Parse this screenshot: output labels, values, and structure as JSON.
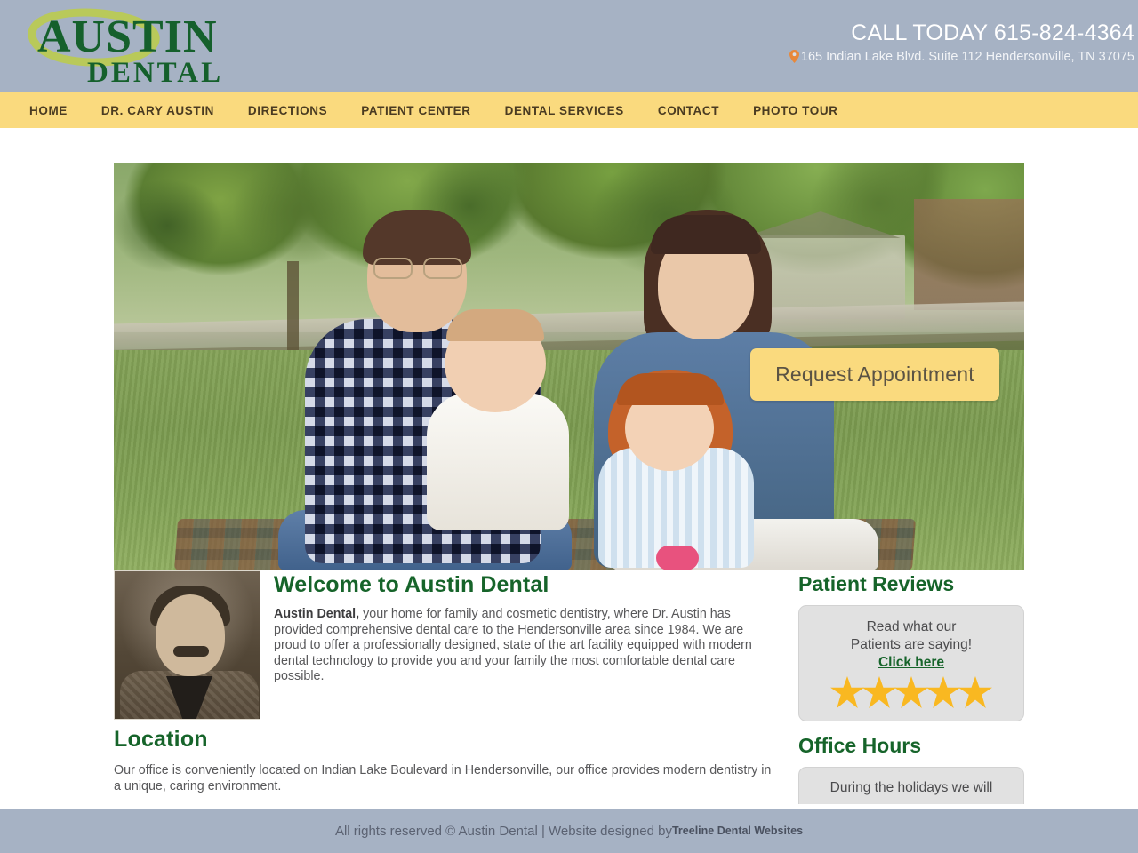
{
  "header": {
    "logo": {
      "primary": "AUSTIN",
      "secondary": "DENTAL",
      "green": "#15602c",
      "swoosh": "#b9c95a"
    },
    "call_today": "CALL TODAY 615-824-4364",
    "address": "165 Indian Lake Blvd. Suite 112 Hendersonville, TN 37075",
    "pin_icon": "map-pin-icon",
    "pin_color": "#e8883a",
    "background": "#a6b2c4"
  },
  "nav": {
    "background": "#fada7e",
    "items": [
      {
        "label": "HOME"
      },
      {
        "label": "DR. CARY AUSTIN"
      },
      {
        "label": "DIRECTIONS"
      },
      {
        "label": "PATIENT CENTER"
      },
      {
        "label": "DENTAL SERVICES"
      },
      {
        "label": "CONTACT"
      },
      {
        "label": "PHOTO TOUR"
      }
    ]
  },
  "hero": {
    "alt": "Family of four sitting on a blanket on grass in a park",
    "cta_label": "Request Appointment",
    "cta_background": "#fada7e",
    "cta_text_color": "#5b5344"
  },
  "main": {
    "doctor_photo_alt": "Portrait of Dr. Cary Austin",
    "welcome_heading": "Welcome to Austin Dental",
    "welcome_lead": "Austin Dental,",
    "welcome_body": " your home for family and cosmetic dentistry, where Dr. Austin has provided comprehensive dental care to the Hendersonville area since 1984. We are proud to offer a professionally designed, state of the art facility equipped with modern dental technology to provide you and your family the most comfortable dental care possible.",
    "location_heading": "Location",
    "location_body": "Our office is conveniently located on Indian Lake Boulevard in Hendersonville, our office provides modern dentistry in a unique, caring environment.",
    "heading_color": "#16642a"
  },
  "sidebar": {
    "reviews_heading": "Patient Reviews",
    "reviews_line1": "Read what our",
    "reviews_line2": "Patients are saying!",
    "reviews_link": "Click here",
    "star_count": 5,
    "star_color": "#f9b821",
    "hours_heading": "Office Hours",
    "hours_text": "During the holidays we will"
  },
  "footer": {
    "text": "All rights reserved © Austin Dental | Website designed by ",
    "brand": "Treeline Dental Websites",
    "background": "#a6b2c4"
  }
}
